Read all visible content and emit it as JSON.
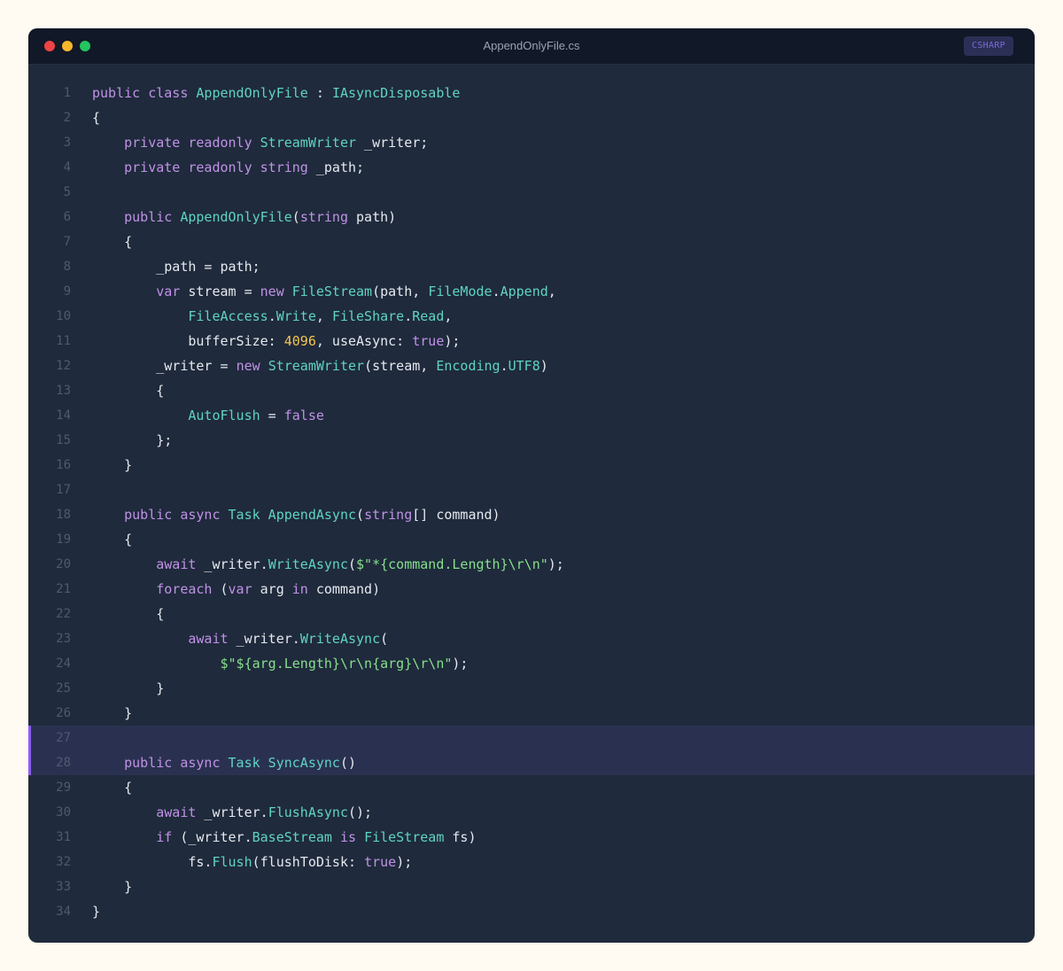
{
  "window": {
    "filename": "AppendOnlyFile.cs",
    "language_badge": "CSHARP"
  },
  "colors": {
    "page_background": "#fffbf3",
    "editor_background": "#1f2a3c",
    "titlebar_background": "#111827",
    "highlight_background": "#2a3150",
    "highlight_bar": "#8b5cf6",
    "close_dot": "#ef4444",
    "minimize_dot": "#f5b72c",
    "maximize_dot": "#22c55e",
    "badge_background": "#2c2f55",
    "badge_text": "#7c68d9",
    "plain": "#e6e9ef",
    "keyword": "#c092e6",
    "type": "#5fd4c2",
    "string": "#86e08c",
    "number": "#f5c451",
    "line_number": "#4d5a70"
  },
  "editor": {
    "highlighted_lines": [
      27,
      28
    ],
    "lines": [
      {
        "number": "1",
        "tokens": [
          {
            "t": "public class ",
            "k": "keyword"
          },
          {
            "t": "AppendOnlyFile",
            "k": "type"
          },
          {
            "t": " : ",
            "k": "plain"
          },
          {
            "t": "IAsyncDisposable",
            "k": "type"
          }
        ]
      },
      {
        "number": "2",
        "tokens": [
          {
            "t": "{",
            "k": "plain"
          }
        ]
      },
      {
        "number": "3",
        "tokens": [
          {
            "t": "    private readonly ",
            "k": "keyword"
          },
          {
            "t": "StreamWriter",
            "k": "type"
          },
          {
            "t": " _writer;",
            "k": "plain"
          }
        ]
      },
      {
        "number": "4",
        "tokens": [
          {
            "t": "    private readonly string",
            "k": "keyword"
          },
          {
            "t": " _path;",
            "k": "plain"
          }
        ]
      },
      {
        "number": "5",
        "tokens": []
      },
      {
        "number": "6",
        "tokens": [
          {
            "t": "    public ",
            "k": "keyword"
          },
          {
            "t": "AppendOnlyFile",
            "k": "type"
          },
          {
            "t": "(",
            "k": "plain"
          },
          {
            "t": "string",
            "k": "keyword"
          },
          {
            "t": " path)",
            "k": "plain"
          }
        ]
      },
      {
        "number": "7",
        "tokens": [
          {
            "t": "    {",
            "k": "plain"
          }
        ]
      },
      {
        "number": "8",
        "tokens": [
          {
            "t": "        _path = path;",
            "k": "plain"
          }
        ]
      },
      {
        "number": "9",
        "tokens": [
          {
            "t": "        var",
            "k": "keyword"
          },
          {
            "t": " stream = ",
            "k": "plain"
          },
          {
            "t": "new ",
            "k": "keyword"
          },
          {
            "t": "FileStream",
            "k": "type"
          },
          {
            "t": "(path, ",
            "k": "plain"
          },
          {
            "t": "FileMode",
            "k": "type"
          },
          {
            "t": ".",
            "k": "plain"
          },
          {
            "t": "Append",
            "k": "type"
          },
          {
            "t": ",",
            "k": "plain"
          }
        ]
      },
      {
        "number": "10",
        "tokens": [
          {
            "t": "            ",
            "k": "plain"
          },
          {
            "t": "FileAccess",
            "k": "type"
          },
          {
            "t": ".",
            "k": "plain"
          },
          {
            "t": "Write",
            "k": "type"
          },
          {
            "t": ", ",
            "k": "plain"
          },
          {
            "t": "FileShare",
            "k": "type"
          },
          {
            "t": ".",
            "k": "plain"
          },
          {
            "t": "Read",
            "k": "type"
          },
          {
            "t": ",",
            "k": "plain"
          }
        ]
      },
      {
        "number": "11",
        "tokens": [
          {
            "t": "            bufferSize: ",
            "k": "plain"
          },
          {
            "t": "4096",
            "k": "number"
          },
          {
            "t": ", useAsync: ",
            "k": "plain"
          },
          {
            "t": "true",
            "k": "keyword"
          },
          {
            "t": ");",
            "k": "plain"
          }
        ]
      },
      {
        "number": "12",
        "tokens": [
          {
            "t": "        _writer = ",
            "k": "plain"
          },
          {
            "t": "new ",
            "k": "keyword"
          },
          {
            "t": "StreamWriter",
            "k": "type"
          },
          {
            "t": "(stream, ",
            "k": "plain"
          },
          {
            "t": "Encoding",
            "k": "type"
          },
          {
            "t": ".",
            "k": "plain"
          },
          {
            "t": "UTF8",
            "k": "type"
          },
          {
            "t": ")",
            "k": "plain"
          }
        ]
      },
      {
        "number": "13",
        "tokens": [
          {
            "t": "        {",
            "k": "plain"
          }
        ]
      },
      {
        "number": "14",
        "tokens": [
          {
            "t": "            ",
            "k": "plain"
          },
          {
            "t": "AutoFlush",
            "k": "type"
          },
          {
            "t": " = ",
            "k": "plain"
          },
          {
            "t": "false",
            "k": "keyword"
          }
        ]
      },
      {
        "number": "15",
        "tokens": [
          {
            "t": "        };",
            "k": "plain"
          }
        ]
      },
      {
        "number": "16",
        "tokens": [
          {
            "t": "    }",
            "k": "plain"
          }
        ]
      },
      {
        "number": "17",
        "tokens": []
      },
      {
        "number": "18",
        "tokens": [
          {
            "t": "    public async ",
            "k": "keyword"
          },
          {
            "t": "Task AppendAsync",
            "k": "type"
          },
          {
            "t": "(",
            "k": "plain"
          },
          {
            "t": "string",
            "k": "keyword"
          },
          {
            "t": "[] command)",
            "k": "plain"
          }
        ]
      },
      {
        "number": "19",
        "tokens": [
          {
            "t": "    {",
            "k": "plain"
          }
        ]
      },
      {
        "number": "20",
        "tokens": [
          {
            "t": "        await",
            "k": "keyword"
          },
          {
            "t": " _writer.",
            "k": "plain"
          },
          {
            "t": "WriteAsync",
            "k": "type"
          },
          {
            "t": "(",
            "k": "plain"
          },
          {
            "t": "$\"*{command.Length}\\r\\n\"",
            "k": "string"
          },
          {
            "t": ");",
            "k": "plain"
          }
        ]
      },
      {
        "number": "21",
        "tokens": [
          {
            "t": "        foreach",
            "k": "keyword"
          },
          {
            "t": " (",
            "k": "plain"
          },
          {
            "t": "var",
            "k": "keyword"
          },
          {
            "t": " arg ",
            "k": "plain"
          },
          {
            "t": "in",
            "k": "keyword"
          },
          {
            "t": " command)",
            "k": "plain"
          }
        ]
      },
      {
        "number": "22",
        "tokens": [
          {
            "t": "        {",
            "k": "plain"
          }
        ]
      },
      {
        "number": "23",
        "tokens": [
          {
            "t": "            await",
            "k": "keyword"
          },
          {
            "t": " _writer.",
            "k": "plain"
          },
          {
            "t": "WriteAsync",
            "k": "type"
          },
          {
            "t": "(",
            "k": "plain"
          }
        ]
      },
      {
        "number": "24",
        "tokens": [
          {
            "t": "                ",
            "k": "plain"
          },
          {
            "t": "$\"${arg.Length}\\r\\n{arg}\\r\\n\"",
            "k": "string"
          },
          {
            "t": ");",
            "k": "plain"
          }
        ]
      },
      {
        "number": "25",
        "tokens": [
          {
            "t": "        }",
            "k": "plain"
          }
        ]
      },
      {
        "number": "26",
        "tokens": [
          {
            "t": "    }",
            "k": "plain"
          }
        ]
      },
      {
        "number": "27",
        "tokens": []
      },
      {
        "number": "28",
        "tokens": [
          {
            "t": "    public async ",
            "k": "keyword"
          },
          {
            "t": "Task SyncAsync",
            "k": "type"
          },
          {
            "t": "()",
            "k": "plain"
          }
        ]
      },
      {
        "number": "29",
        "tokens": [
          {
            "t": "    {",
            "k": "plain"
          }
        ]
      },
      {
        "number": "30",
        "tokens": [
          {
            "t": "        await",
            "k": "keyword"
          },
          {
            "t": " _writer.",
            "k": "plain"
          },
          {
            "t": "FlushAsync",
            "k": "type"
          },
          {
            "t": "();",
            "k": "plain"
          }
        ]
      },
      {
        "number": "31",
        "tokens": [
          {
            "t": "        if",
            "k": "keyword"
          },
          {
            "t": " (_writer.",
            "k": "plain"
          },
          {
            "t": "BaseStream",
            "k": "type"
          },
          {
            "t": " ",
            "k": "plain"
          },
          {
            "t": "is",
            "k": "keyword"
          },
          {
            "t": " ",
            "k": "plain"
          },
          {
            "t": "FileStream",
            "k": "type"
          },
          {
            "t": " fs)",
            "k": "plain"
          }
        ]
      },
      {
        "number": "32",
        "tokens": [
          {
            "t": "            fs.",
            "k": "plain"
          },
          {
            "t": "Flush",
            "k": "type"
          },
          {
            "t": "(flushToDisk: ",
            "k": "plain"
          },
          {
            "t": "true",
            "k": "keyword"
          },
          {
            "t": ");",
            "k": "plain"
          }
        ]
      },
      {
        "number": "33",
        "tokens": [
          {
            "t": "    }",
            "k": "plain"
          }
        ]
      },
      {
        "number": "34",
        "tokens": [
          {
            "t": "}",
            "k": "plain"
          }
        ]
      }
    ]
  }
}
